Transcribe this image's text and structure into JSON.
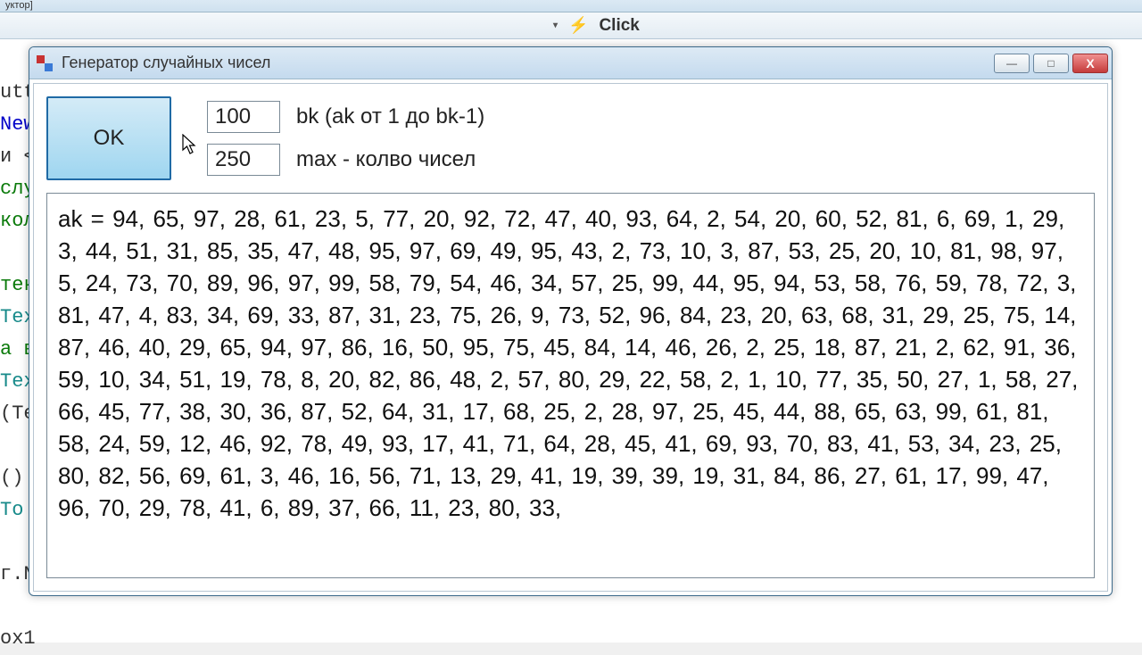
{
  "background": {
    "top_text": "уктор]",
    "toolbar_label": "Click",
    "code_fragments": [
      {
        "t": "",
        "c": ""
      },
      {
        "t": "utt",
        "c": ""
      },
      {
        "t": "New",
        "c": "c-blue"
      },
      {
        "t": "и <",
        "c": ""
      },
      {
        "t": "слу",
        "c": "c-green"
      },
      {
        "t": "кол",
        "c": "c-green"
      },
      {
        "t": "",
        "c": ""
      },
      {
        "t": "тек",
        "c": "c-green"
      },
      {
        "t": "Tex",
        "c": "c-teal"
      },
      {
        "t": "а в",
        "c": "c-green"
      },
      {
        "t": "Tex",
        "c": "c-teal"
      },
      {
        "t": "(Te",
        "c": ""
      },
      {
        "t": "",
        "c": ""
      },
      {
        "t": "()",
        "c": ""
      },
      {
        "t": "To",
        "c": "c-teal"
      },
      {
        "t": "",
        "c": ""
      },
      {
        "t": "г.N",
        "c": ""
      },
      {
        "t": "",
        "c": ""
      },
      {
        "t": "ox1",
        "c": ""
      }
    ]
  },
  "window": {
    "title": "Генератор случайных чисел",
    "ok_label": "OK",
    "bk_value": "100",
    "bk_label": "bk  (ak от 1 до bk-1)",
    "max_value": "250",
    "max_label": "max - колво чисел",
    "output_prefix": "ak = ",
    "min_glyph": "—",
    "max_glyph": "□",
    "close_glyph": "X",
    "numbers": [
      94,
      65,
      97,
      28,
      61,
      23,
      5,
      77,
      20,
      92,
      72,
      47,
      40,
      93,
      64,
      2,
      54,
      20,
      60,
      52,
      81,
      6,
      69,
      1,
      29,
      3,
      44,
      51,
      31,
      85,
      35,
      47,
      48,
      95,
      97,
      69,
      49,
      95,
      43,
      2,
      73,
      10,
      3,
      87,
      53,
      25,
      20,
      10,
      81,
      98,
      97,
      5,
      24,
      73,
      70,
      89,
      96,
      97,
      99,
      58,
      79,
      54,
      46,
      34,
      57,
      25,
      99,
      44,
      95,
      94,
      53,
      58,
      76,
      59,
      78,
      72,
      3,
      81,
      47,
      4,
      83,
      34,
      69,
      33,
      87,
      31,
      23,
      75,
      26,
      9,
      73,
      52,
      96,
      84,
      23,
      20,
      63,
      68,
      31,
      29,
      25,
      75,
      14,
      87,
      46,
      40,
      29,
      65,
      94,
      97,
      86,
      16,
      50,
      95,
      75,
      45,
      84,
      14,
      46,
      26,
      2,
      25,
      18,
      87,
      21,
      2,
      62,
      91,
      36,
      59,
      10,
      34,
      51,
      19,
      78,
      8,
      20,
      82,
      86,
      48,
      2,
      57,
      80,
      29,
      22,
      58,
      2,
      1,
      10,
      77,
      35,
      50,
      27,
      1,
      58,
      27,
      66,
      45,
      77,
      38,
      30,
      36,
      87,
      52,
      64,
      31,
      17,
      68,
      25,
      2,
      28,
      97,
      25,
      45,
      44,
      88,
      65,
      63,
      99,
      61,
      81,
      58,
      24,
      59,
      12,
      46,
      92,
      78,
      49,
      93,
      17,
      41,
      71,
      64,
      28,
      45,
      41,
      69,
      93,
      70,
      83,
      41,
      53,
      34,
      23,
      25,
      80,
      82,
      56,
      69,
      61,
      3,
      46,
      16,
      56,
      71,
      13,
      29,
      41,
      19,
      39,
      39,
      19,
      31,
      84,
      86,
      27,
      61,
      17,
      99,
      47,
      96,
      70,
      29,
      78,
      41,
      6,
      89,
      37,
      66,
      11,
      23,
      80,
      33
    ]
  }
}
